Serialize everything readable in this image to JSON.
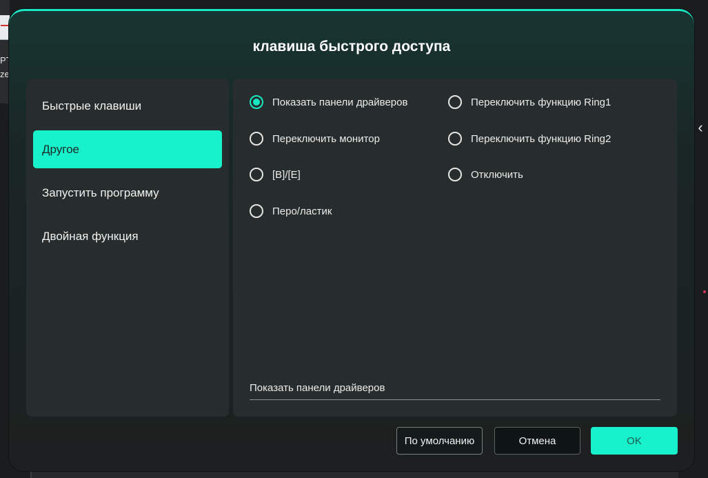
{
  "background": {
    "left_text_1": "PT",
    "left_text_2": "ze",
    "chevron": "‹"
  },
  "dialog": {
    "title": "клавиша быстрого доступа",
    "sidebar": {
      "items": [
        {
          "label": "Быстрые клавиши",
          "active": false
        },
        {
          "label": "Другое",
          "active": true
        },
        {
          "label": "Запустить программу",
          "active": false
        },
        {
          "label": "Двойная функция",
          "active": false
        }
      ]
    },
    "options": {
      "show_driver_panels": {
        "label": "Показать панели драйверов",
        "checked": true
      },
      "switch_monitor": {
        "label": "Переключить монитор",
        "checked": false
      },
      "be": {
        "label": "[B]/[E]",
        "checked": false
      },
      "pen_eraser": {
        "label": "Перо/ластик",
        "checked": false
      },
      "switch_ring1": {
        "label": "Переключить функцию Ring1",
        "checked": false
      },
      "switch_ring2": {
        "label": "Переключить функцию Ring2",
        "checked": false
      },
      "disable": {
        "label": "Отключить",
        "checked": false
      }
    },
    "selected_summary": "Показать панели драйверов",
    "buttons": {
      "default": "По умолчанию",
      "cancel": "Отмена",
      "ok": "OK"
    }
  },
  "colors": {
    "accent": "#19e8c4",
    "panel": "#262d2c"
  }
}
